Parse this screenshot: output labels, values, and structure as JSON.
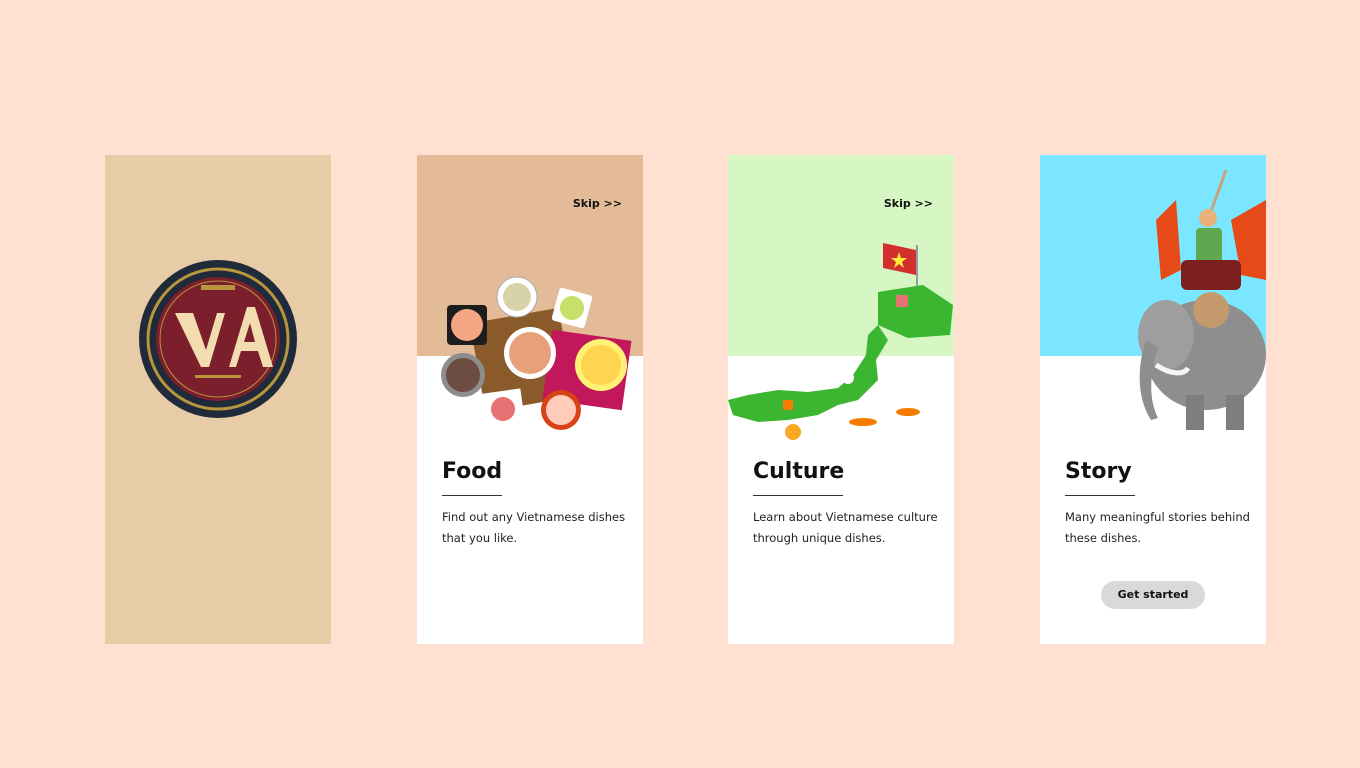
{
  "colors": {
    "page_bg": "#FFE0D1",
    "splash_bg": "#E8CCA8",
    "food_band": "#E4BB98",
    "culture_band": "#D6F7C4",
    "story_band": "#7BE6FF",
    "button_bg": "#D9D9D9",
    "logo_maroon": "#7A1F2B",
    "logo_gold": "#F3DDB0",
    "logo_ring": "#1F2A3A"
  },
  "splash": {
    "logo_text": "VA"
  },
  "screens": {
    "food": {
      "skip": "Skip >>",
      "title": "Food",
      "description": "Find out any Vietnamese dishes that you like.",
      "illustration_icon": "vietnamese-dishes-illustration"
    },
    "culture": {
      "skip": "Skip >>",
      "title": "Culture",
      "description": "Learn about Vietnamese culture through unique dishes.",
      "illustration_icon": "vietnam-map-illustration"
    },
    "story": {
      "title": "Story",
      "description": "Many meaningful stories behind these dishes.",
      "button": "Get started",
      "illustration_icon": "warrior-on-elephant-illustration"
    }
  }
}
